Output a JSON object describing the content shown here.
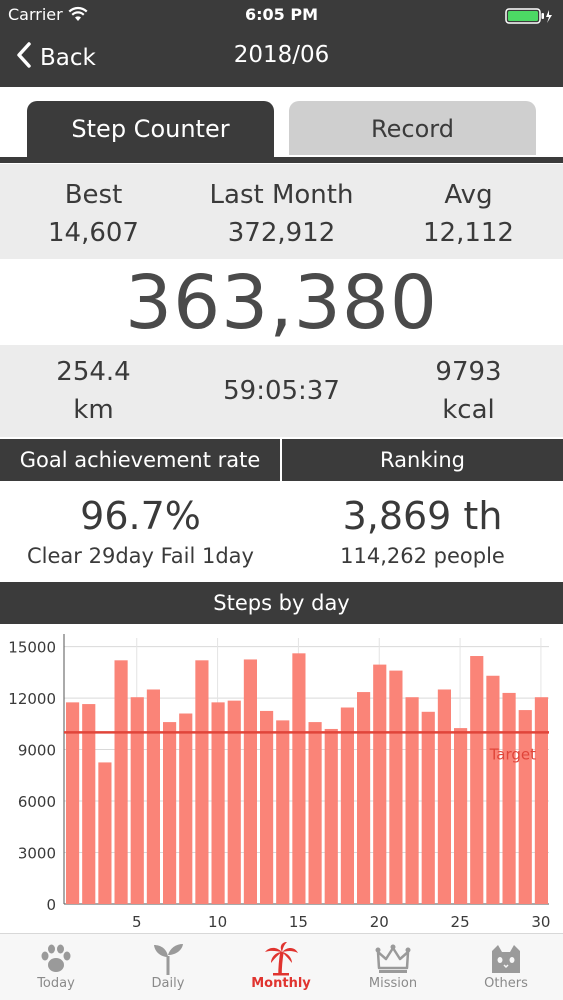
{
  "status_bar": {
    "carrier": "Carrier",
    "time": "6:05 PM"
  },
  "nav": {
    "back_label": "Back",
    "title": "2018/06"
  },
  "tabs": [
    {
      "label": "Step Counter",
      "active": true
    },
    {
      "label": "Record",
      "active": false
    }
  ],
  "summary": {
    "best_label": "Best",
    "best_value": "14,607",
    "last_month_label": "Last Month",
    "last_month_value": "372,912",
    "avg_label": "Avg",
    "avg_value": "12,112",
    "total_steps": "363,380",
    "distance_value": "254.4",
    "distance_unit": "km",
    "duration": "59:05:37",
    "calories_value": "9793",
    "calories_unit": "kcal"
  },
  "goal": {
    "header": "Goal achievement rate",
    "rate": "96.7%",
    "detail": "Clear 29day Fail 1day"
  },
  "ranking": {
    "header": "Ranking",
    "rank": "3,869 th",
    "people": "114,262 people"
  },
  "chart_header": "Steps by day",
  "chart_data": {
    "type": "bar",
    "x": [
      1,
      2,
      3,
      4,
      5,
      6,
      7,
      8,
      9,
      10,
      11,
      12,
      13,
      14,
      15,
      16,
      17,
      18,
      19,
      20,
      21,
      22,
      23,
      24,
      25,
      26,
      27,
      28,
      29,
      30
    ],
    "values": [
      11750,
      11650,
      8250,
      14200,
      12050,
      12500,
      10600,
      11100,
      14200,
      11750,
      11850,
      14250,
      11250,
      10700,
      14607,
      10600,
      10200,
      11450,
      12350,
      13950,
      13600,
      12050,
      11200,
      12500,
      10250,
      14450,
      13300,
      12300,
      11300,
      12050
    ],
    "xticks": [
      5,
      10,
      15,
      20,
      25,
      30
    ],
    "yticks": [
      0,
      3000,
      6000,
      9000,
      12000,
      15000
    ],
    "ylim": [
      0,
      15500
    ],
    "target_value": 10000,
    "target_label": "Target",
    "bar_color": "#fa8478",
    "target_color": "#e0453a"
  },
  "tabbar": [
    {
      "label": "Today",
      "icon": "paw-icon",
      "active": false
    },
    {
      "label": "Daily",
      "icon": "sprout-icon",
      "active": false
    },
    {
      "label": "Monthly",
      "icon": "palm-tree-icon",
      "active": true
    },
    {
      "label": "Mission",
      "icon": "crown-icon",
      "active": false
    },
    {
      "label": "Others",
      "icon": "cat-icon",
      "active": false
    }
  ],
  "colors": {
    "dark": "#3b3b3b",
    "light_gray": "#ececec",
    "accent": "#e0342f",
    "battery": "#4cd964"
  }
}
